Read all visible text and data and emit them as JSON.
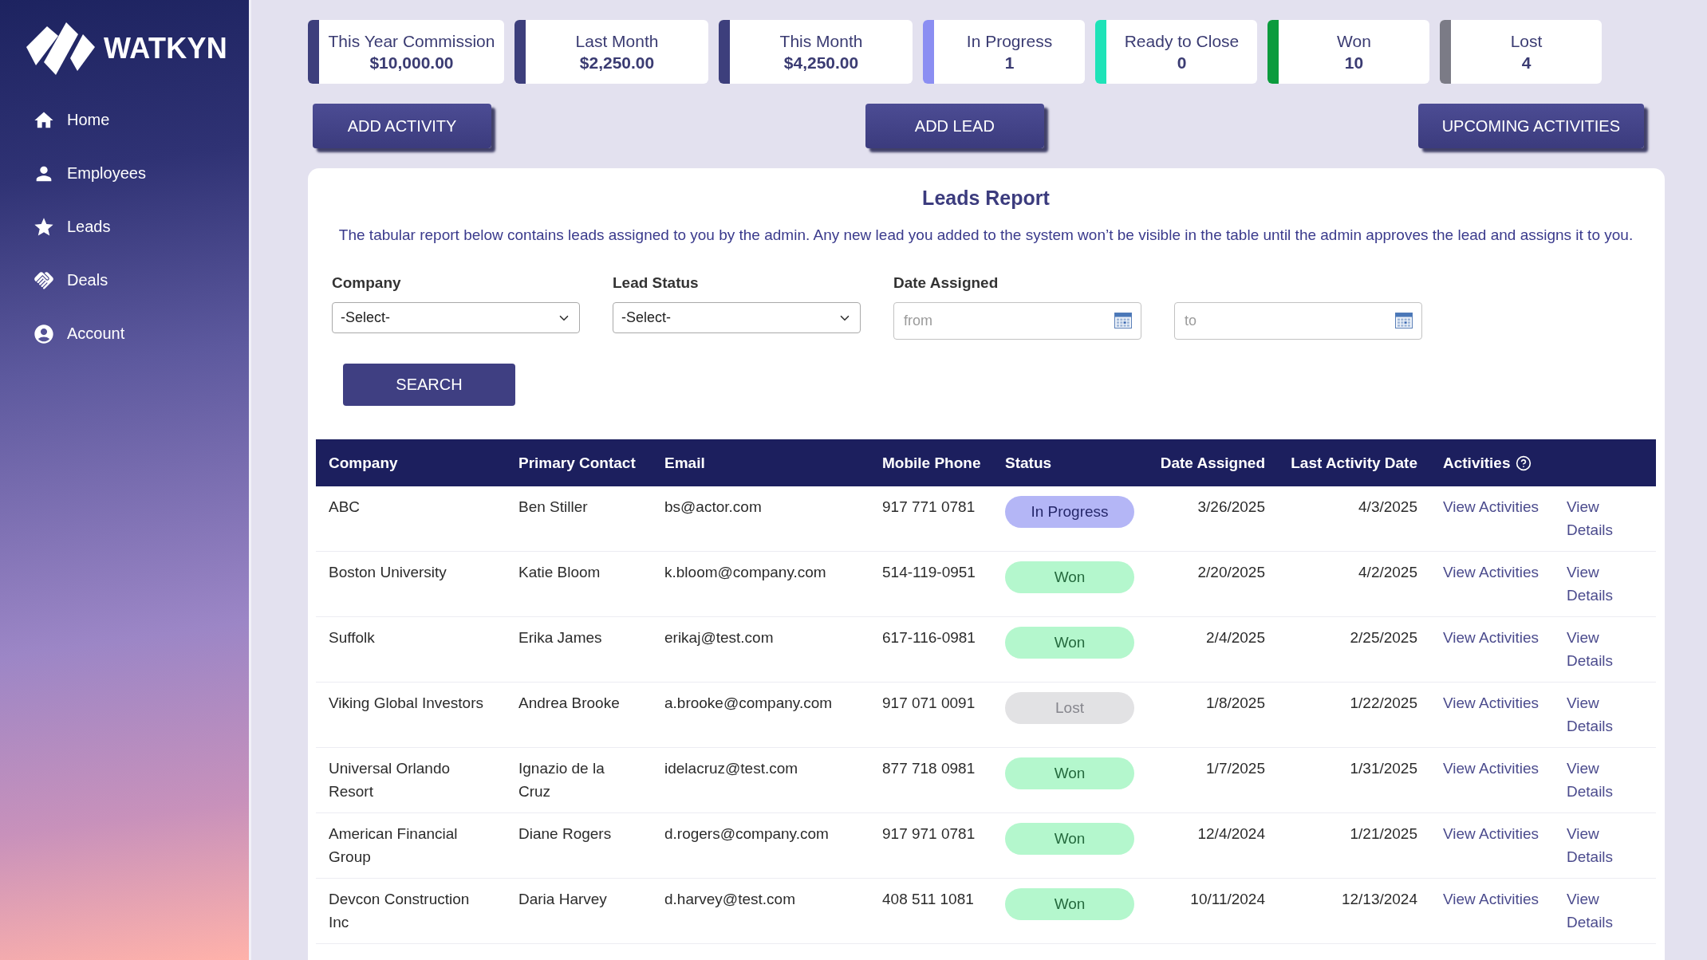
{
  "sidebar": {
    "logo": "WATKYN",
    "nav": [
      "Home",
      "Employees",
      "Leads",
      "Deals",
      "Account"
    ]
  },
  "stats": [
    {
      "label": "This Year Commission",
      "value": "$10,000.00",
      "color": "#3d3f7c"
    },
    {
      "label": "Last Month",
      "value": "$2,250.00",
      "color": "#3d3f7c"
    },
    {
      "label": "This Month",
      "value": "$4,250.00",
      "color": "#3d3f7c"
    },
    {
      "label": "In Progress",
      "value": "1",
      "color": "#8b8ef2"
    },
    {
      "label": "Ready to Close",
      "value": "0",
      "color": "#1ee3b8"
    },
    {
      "label": "Won",
      "value": "10",
      "color": "#0b9b3d"
    },
    {
      "label": "Lost",
      "value": "4",
      "color": "#7b7b86"
    }
  ],
  "actions": [
    "ADD ACTIVITY",
    "ADD LEAD",
    "UPCOMING ACTIVITIES"
  ],
  "report": {
    "title": "Leads Report",
    "description": "The tabular report below contains leads assigned to you by the admin. Any new lead you added to the system won’t be visible in the table until the admin approves the lead and assigns it to you.",
    "filters": [
      {
        "kind": "select",
        "label": "Company",
        "value": "-Select-"
      },
      {
        "kind": "select",
        "label": "Lead Status",
        "value": "-Select-"
      },
      {
        "kind": "date_range",
        "label": "Date Assigned",
        "from_placeholder": "from",
        "to_placeholder": "to"
      }
    ],
    "search_button": "SEARCH"
  },
  "table": {
    "columns": [
      {
        "label": "Company",
        "help": false
      },
      {
        "label": "Primary Contact",
        "help": false
      },
      {
        "label": "Email",
        "help": false
      },
      {
        "label": "Mobile Phone",
        "help": false
      },
      {
        "label": "Status",
        "help": false
      },
      {
        "label": "Date Assigned",
        "help": false
      },
      {
        "label": "Last Activity Date",
        "help": false
      },
      {
        "label": "Activities",
        "help": true
      }
    ],
    "rows": [
      {
        "company": "ABC",
        "primary_contact": "Ben Stiller",
        "email": "bs@actor.com",
        "mobile_phone": "917 771 0781",
        "status": {
          "label": "In Progress",
          "color": "#b4b6f6"
        },
        "date_assigned": "3/26/2025",
        "last_activity_date": "4/3/2025",
        "activities_link": "View Activities",
        "details_link": "View Details"
      },
      {
        "company": "Boston University",
        "primary_contact": "Katie Bloom",
        "email": "k.bloom@company.com",
        "mobile_phone": "514-119-0951",
        "status": {
          "label": "Won",
          "color": "#b4f7cd"
        },
        "date_assigned": "2/20/2025",
        "last_activity_date": "4/2/2025",
        "activities_link": "View Activities",
        "details_link": "View Details"
      },
      {
        "company": "Suffolk",
        "primary_contact": "Erika James",
        "email": "erikaj@test.com",
        "mobile_phone": "617-116-0981",
        "status": {
          "label": "Won",
          "color": "#b4f7cd"
        },
        "date_assigned": "2/4/2025",
        "last_activity_date": "2/25/2025",
        "activities_link": "View Activities",
        "details_link": "View Details"
      },
      {
        "company": "Viking Global Investors",
        "primary_contact": "Andrea Brooke",
        "email": "a.brooke@company.com",
        "mobile_phone": "917 071 0091",
        "status": {
          "label": "Lost",
          "color": "#e2e2e4"
        },
        "date_assigned": "1/8/2025",
        "last_activity_date": "1/22/2025",
        "activities_link": "View Activities",
        "details_link": "View Details"
      },
      {
        "company": "Universal Orlando Resort",
        "primary_contact": "Ignazio de la Cruz",
        "email": "idelacruz@test.com",
        "mobile_phone": "877 718 0981",
        "status": {
          "label": "Won",
          "color": "#b4f7cd"
        },
        "date_assigned": "1/7/2025",
        "last_activity_date": "1/31/2025",
        "activities_link": "View Activities",
        "details_link": "View Details"
      },
      {
        "company": "American Financial Group",
        "primary_contact": "Diane Rogers",
        "email": "d.rogers@company.com",
        "mobile_phone": "917 971 0781",
        "status": {
          "label": "Won",
          "color": "#b4f7cd"
        },
        "date_assigned": "12/4/2024",
        "last_activity_date": "1/21/2025",
        "activities_link": "View Activities",
        "details_link": "View Details"
      },
      {
        "company": "Devcon Construction Inc",
        "primary_contact": "Daria Harvey",
        "email": "d.harvey@test.com",
        "mobile_phone": "408 511 1081",
        "status": {
          "label": "Won",
          "color": "#b4f7cd"
        },
        "date_assigned": "10/11/2024",
        "last_activity_date": "12/13/2024",
        "activities_link": "View Activities",
        "details_link": "View Details"
      }
    ]
  }
}
